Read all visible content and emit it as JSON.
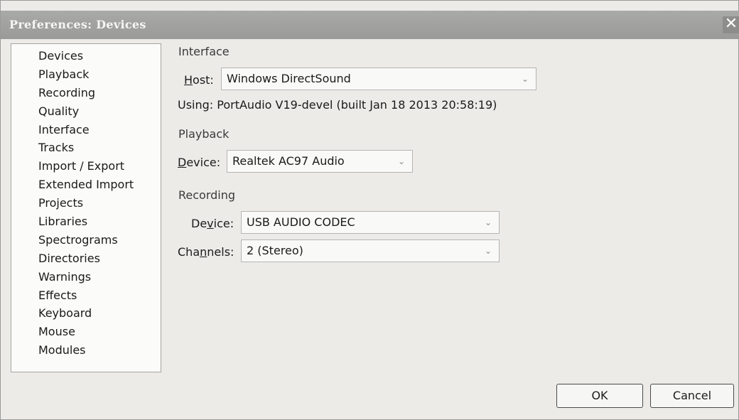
{
  "window": {
    "title": "Preferences: Devices",
    "close_glyph": "✕"
  },
  "sidebar": {
    "items": [
      {
        "label": "Devices"
      },
      {
        "label": "Playback"
      },
      {
        "label": "Recording"
      },
      {
        "label": "Quality"
      },
      {
        "label": "Interface"
      },
      {
        "label": "Tracks"
      },
      {
        "label": "Import / Export"
      },
      {
        "label": "Extended Import"
      },
      {
        "label": "Projects"
      },
      {
        "label": "Libraries"
      },
      {
        "label": "Spectrograms"
      },
      {
        "label": "Directories"
      },
      {
        "label": "Warnings"
      },
      {
        "label": "Effects"
      },
      {
        "label": "Keyboard"
      },
      {
        "label": "Mouse"
      },
      {
        "label": "Modules"
      }
    ]
  },
  "interface": {
    "heading": "Interface",
    "host_label_mnemonic": "H",
    "host_label_rest": "ost:",
    "host_value": "Windows DirectSound",
    "using_text": "Using: PortAudio V19-devel (built Jan 18 2013 20:58:19)"
  },
  "playback": {
    "heading": "Playback",
    "device_label_mnemonic": "D",
    "device_label_rest": "evice:",
    "device_value": "Realtek AC97 Audio"
  },
  "recording": {
    "heading": "Recording",
    "device_label_pre": "De",
    "device_label_mnemonic": "v",
    "device_label_post": "ice:",
    "device_value": "USB AUDIO  CODEC",
    "channels_label_pre": "Cha",
    "channels_label_mnemonic": "n",
    "channels_label_post": "nels:",
    "channels_value": "2 (Stereo)"
  },
  "dropdown_arrow": "⌄",
  "buttons": {
    "ok": "OK",
    "cancel": "Cancel"
  }
}
